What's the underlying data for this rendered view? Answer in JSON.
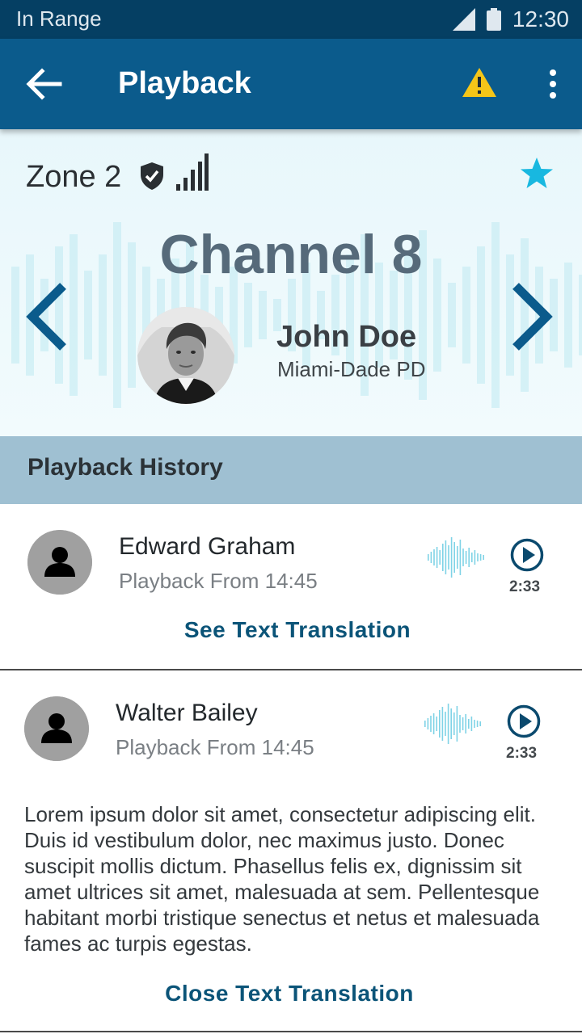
{
  "status_bar": {
    "carrier": "In Range",
    "time": "12:30",
    "icons": [
      "signal-icon",
      "battery-icon"
    ]
  },
  "app_bar": {
    "title": "Playback",
    "icons": [
      "back-arrow-icon",
      "warning-icon",
      "more-vert-icon"
    ],
    "warning_color": "#f5c518"
  },
  "channel": {
    "zone": "Zone 2",
    "zone_icons": [
      "shield-check-icon",
      "signal-bars-icon"
    ],
    "favorite_icon": "star-icon",
    "favorite_color": "#18b8e0",
    "title": "Channel 8",
    "caller": {
      "name": "John Doe",
      "organization": "Miami-Dade PD"
    },
    "nav_icons": [
      "chevron-left-icon",
      "chevron-right-icon"
    ],
    "accent": "#0b5b8c"
  },
  "history": {
    "title": "Playback History",
    "items": [
      {
        "name": "Edward Graham",
        "subtitle": "Playback From 14:45",
        "duration": "2:33",
        "link": "See Text Translation"
      },
      {
        "name": "Walter Bailey",
        "subtitle": "Playback From 14:45",
        "duration": "2:33",
        "translation": "Lorem ipsum dolor sit amet, consectetur adipiscing elit. Duis id vestibulum dolor, nec maximus justo. Donec suscipit mollis dictum. Phasellus felis ex, dignissim sit amet ultrices sit amet, malesuada at sem. Pellentesque habitant morbi tristique senectus et netus et malesuada fames ac turpis egestas.",
        "link": "Close Text Translation"
      }
    ]
  }
}
